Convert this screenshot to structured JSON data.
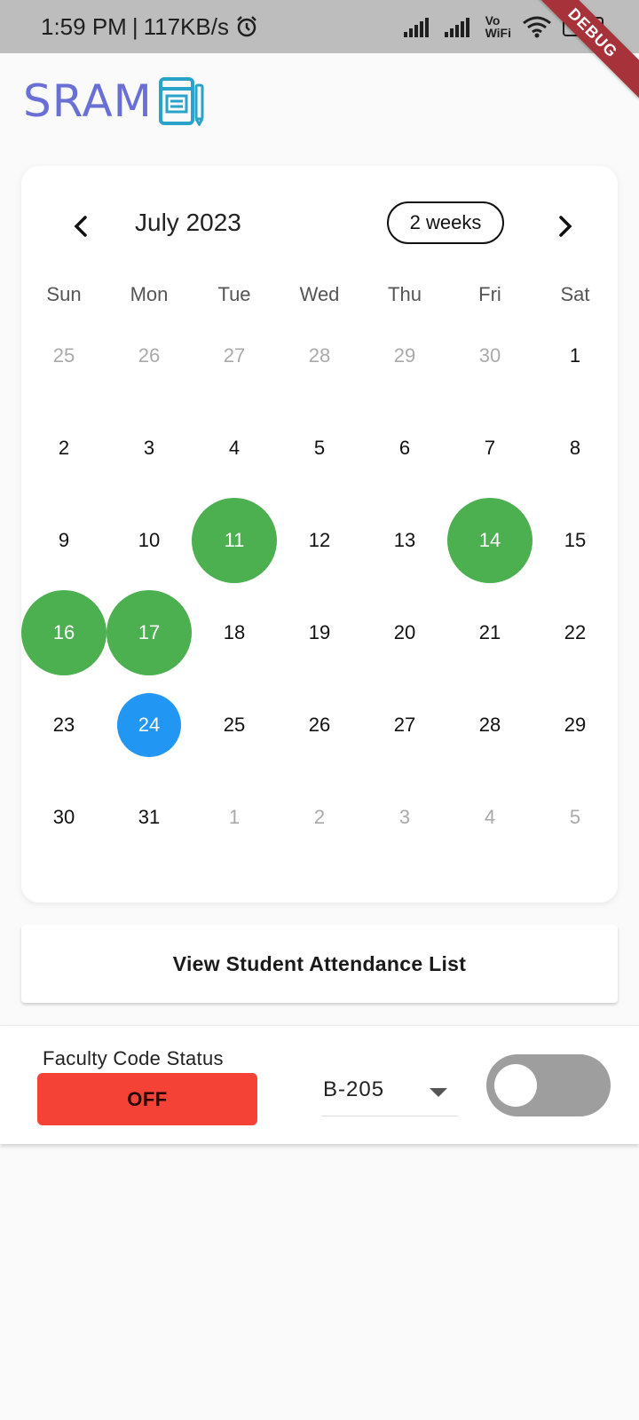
{
  "status_bar": {
    "time": "1:59 PM",
    "separator": "|",
    "speed": "117KB/s",
    "vowifi_top": "Vo",
    "vowifi_bottom": "WiFi",
    "battery": "30",
    "debug_label": "DEBUG",
    "icons": [
      "alarm-icon",
      "signal-icon",
      "signal-icon",
      "wifi-icon",
      "battery-icon"
    ]
  },
  "header": {
    "logo_text": "SRAM",
    "logo_icon": "notebook-pen-icon",
    "logo_color": "#6a6fd6",
    "logo_icon_color": "#29a3c9"
  },
  "calendar": {
    "month_title": "July 2023",
    "format_button": "2 weeks",
    "prev_icon": "chevron-left-icon",
    "next_icon": "chevron-right-icon",
    "weekdays": [
      "Sun",
      "Mon",
      "Tue",
      "Wed",
      "Thu",
      "Fri",
      "Sat"
    ],
    "days": [
      {
        "label": "25",
        "outside": true
      },
      {
        "label": "26",
        "outside": true
      },
      {
        "label": "27",
        "outside": true
      },
      {
        "label": "28",
        "outside": true
      },
      {
        "label": "29",
        "outside": true
      },
      {
        "label": "30",
        "outside": true
      },
      {
        "label": "1"
      },
      {
        "label": "2"
      },
      {
        "label": "3"
      },
      {
        "label": "4"
      },
      {
        "label": "5"
      },
      {
        "label": "6"
      },
      {
        "label": "7"
      },
      {
        "label": "8"
      },
      {
        "label": "9"
      },
      {
        "label": "10"
      },
      {
        "label": "11",
        "status": "present"
      },
      {
        "label": "12"
      },
      {
        "label": "13"
      },
      {
        "label": "14",
        "status": "present"
      },
      {
        "label": "15"
      },
      {
        "label": "16",
        "status": "present"
      },
      {
        "label": "17",
        "status": "present"
      },
      {
        "label": "18"
      },
      {
        "label": "19"
      },
      {
        "label": "20"
      },
      {
        "label": "21"
      },
      {
        "label": "22"
      },
      {
        "label": "23"
      },
      {
        "label": "24",
        "status": "today"
      },
      {
        "label": "25"
      },
      {
        "label": "26"
      },
      {
        "label": "27"
      },
      {
        "label": "28"
      },
      {
        "label": "29"
      },
      {
        "label": "30"
      },
      {
        "label": "31"
      },
      {
        "label": "1",
        "outside": true
      },
      {
        "label": "2",
        "outside": true
      },
      {
        "label": "3",
        "outside": true
      },
      {
        "label": "4",
        "outside": true
      },
      {
        "label": "5",
        "outside": true
      }
    ],
    "colors": {
      "present": "#4caf50",
      "today": "#2196f3",
      "outside_text": "#a9a9a9"
    }
  },
  "attendance_button": {
    "label": "View Student Attendance List"
  },
  "faculty": {
    "code_status_label": "Faculty Code Status",
    "code_status_value": "OFF",
    "code_status_color": "#f44336",
    "room_value": "B-205",
    "room_dropdown_icon": "caret-down-icon",
    "toggle_on": false,
    "toggle_color": "#9e9e9e"
  }
}
